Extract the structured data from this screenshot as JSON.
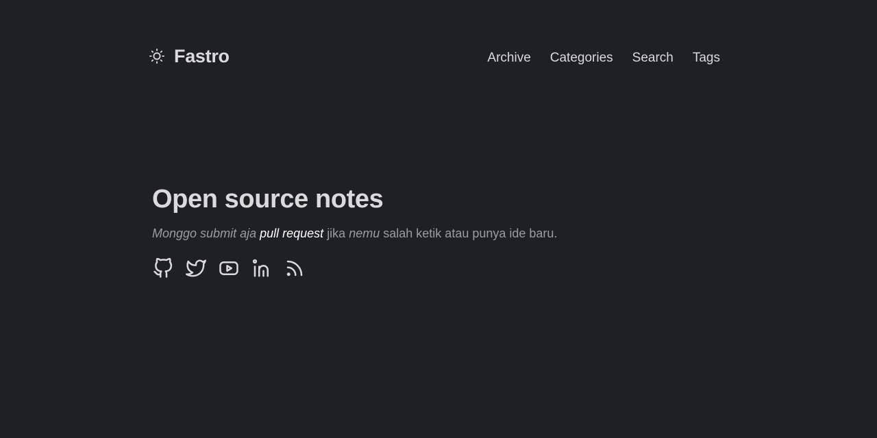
{
  "header": {
    "theme_icon": "sun-icon",
    "site_title": "Fastro",
    "nav": [
      {
        "label": "Archive"
      },
      {
        "label": "Categories"
      },
      {
        "label": "Search"
      },
      {
        "label": "Tags"
      }
    ]
  },
  "hero": {
    "title": "Open source notes",
    "subtitle": {
      "part1": "Monggo submit aja",
      "link": "pull request",
      "part2": "jika",
      "part3": "nemu",
      "part4": "salah ketik atau punya ide baru."
    },
    "social_icons": [
      "github-icon",
      "twitter-icon",
      "youtube-icon",
      "linkedin-icon",
      "rss-icon"
    ]
  },
  "colors": {
    "background": "#1f2023",
    "text": "#dadadb",
    "muted": "#9b9c9d",
    "link": "#ffffff"
  }
}
